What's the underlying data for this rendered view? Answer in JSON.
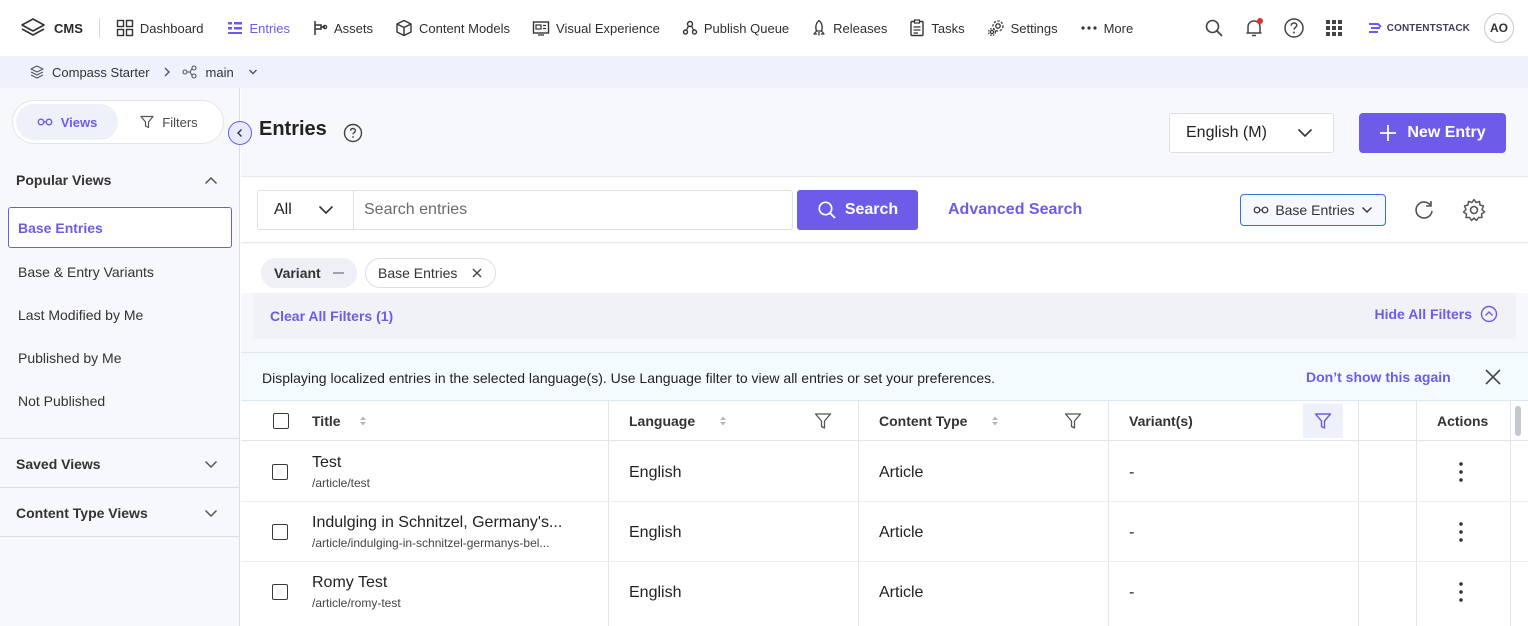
{
  "topnav": {
    "app": "CMS",
    "items": [
      {
        "label": "Dashboard",
        "icon": "dashboard-icon"
      },
      {
        "label": "Entries",
        "icon": "entries-icon",
        "active": true
      },
      {
        "label": "Assets",
        "icon": "assets-icon"
      },
      {
        "label": "Content Models",
        "icon": "cube-icon"
      },
      {
        "label": "Visual Experience",
        "icon": "visual-experience-icon"
      },
      {
        "label": "Publish Queue",
        "icon": "publish-queue-icon"
      },
      {
        "label": "Releases",
        "icon": "rocket-icon"
      },
      {
        "label": "Tasks",
        "icon": "clipboard-icon"
      },
      {
        "label": "Settings",
        "icon": "gear-icon"
      },
      {
        "label": "More",
        "icon": "dots-horizontal-icon"
      }
    ],
    "brand_logo": "CONTENTSTACK",
    "avatar_initials": "AO"
  },
  "breadcrumb": {
    "stack": "Compass Starter",
    "branch": "main"
  },
  "sidebar": {
    "tabs": {
      "views": "Views",
      "filters": "Filters"
    },
    "popular_views": {
      "title": "Popular Views",
      "items": [
        "Base Entries",
        "Base & Entry Variants",
        "Last Modified by Me",
        "Published by Me",
        "Not Published"
      ]
    },
    "saved_views": "Saved Views",
    "content_type_views": "Content Type Views"
  },
  "main": {
    "title": "Entries",
    "language": "English (M)",
    "new_entry": "New Entry",
    "search": {
      "scope": "All",
      "placeholder": "Search entries",
      "button": "Search",
      "advanced": "Advanced Search",
      "view_dropdown": "Base Entries"
    },
    "chips": {
      "variant_label": "Variant",
      "variant_value": "Base Entries"
    },
    "clear_all": "Clear All Filters (1)",
    "hide_all": "Hide All Filters",
    "notice": {
      "message": "Displaying localized entries in the selected language(s). Use Language filter to view all entries or set your preferences.",
      "dont_show": "Don’t show this again"
    },
    "table": {
      "headers": {
        "title": "Title",
        "language": "Language",
        "content_type": "Content Type",
        "variants": "Variant(s)",
        "actions": "Actions"
      },
      "rows": [
        {
          "title": "Test",
          "url": "/article/test",
          "language": "English",
          "content_type": "Article",
          "variants": "-"
        },
        {
          "title": "Indulging in Schnitzel, Germany's...",
          "url": "/article/indulging-in-schnitzel-germanys-bel...",
          "language": "English",
          "content_type": "Article",
          "variants": "-"
        },
        {
          "title": "Romy Test",
          "url": "/article/romy-test",
          "language": "English",
          "content_type": "Article",
          "variants": "-"
        }
      ]
    }
  },
  "colors": {
    "accent": "#6c5ce7",
    "notification_dot": "#e0322b"
  }
}
